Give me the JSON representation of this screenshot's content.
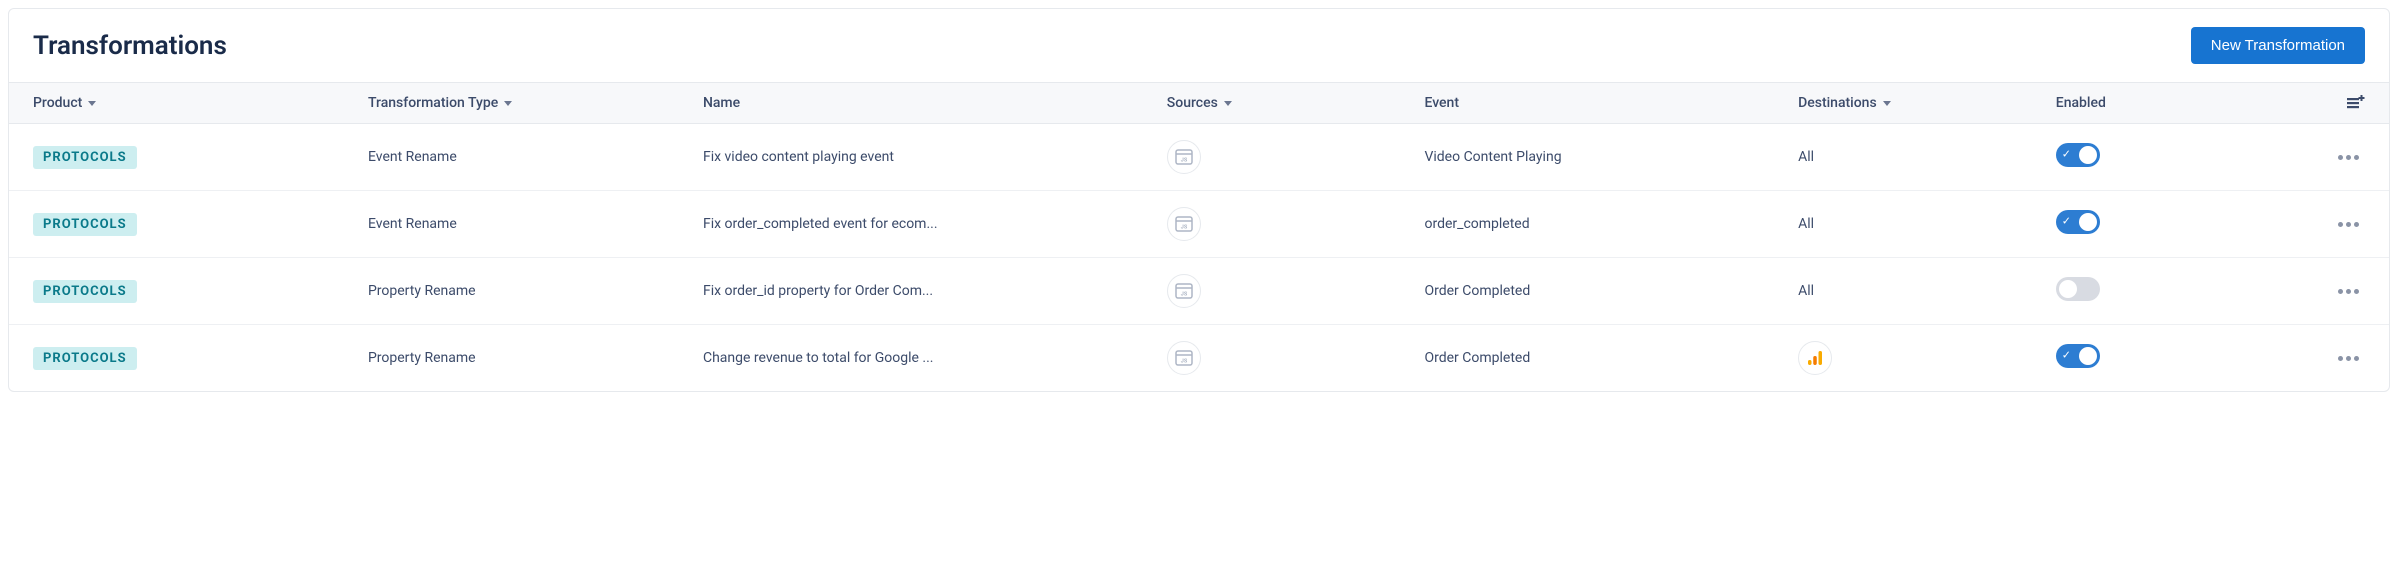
{
  "header": {
    "title": "Transformations",
    "new_button": "New Transformation"
  },
  "columns": {
    "product": "Product",
    "type": "Transformation Type",
    "name": "Name",
    "sources": "Sources",
    "event": "Event",
    "destinations": "Destinations",
    "enabled": "Enabled"
  },
  "rows": [
    {
      "product": "PROTOCOLS",
      "type": "Event Rename",
      "name": "Fix video content playing event",
      "sources_icon": "js",
      "event": "Video Content Playing",
      "destination": "All",
      "destination_kind": "text",
      "enabled": true
    },
    {
      "product": "PROTOCOLS",
      "type": "Event Rename",
      "name": "Fix order_completed event for ecom...",
      "sources_icon": "js",
      "event": "order_completed",
      "destination": "All",
      "destination_kind": "text",
      "enabled": true
    },
    {
      "product": "PROTOCOLS",
      "type": "Property Rename",
      "name": "Fix order_id property for Order Com...",
      "sources_icon": "js",
      "event": "Order Completed",
      "destination": "All",
      "destination_kind": "text",
      "enabled": false
    },
    {
      "product": "PROTOCOLS",
      "type": "Property Rename",
      "name": "Change revenue to total for Google ...",
      "sources_icon": "js",
      "event": "Order Completed",
      "destination": "google-analytics",
      "destination_kind": "icon",
      "enabled": true
    }
  ]
}
